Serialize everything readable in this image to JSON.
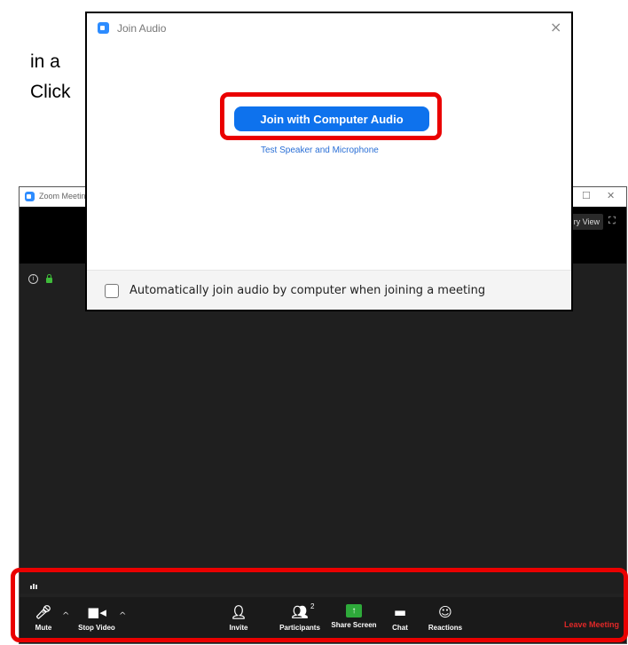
{
  "background": {
    "line1": "in a",
    "line2": "Click"
  },
  "zoom_window": {
    "title": "Zoom Meeting",
    "view_label": "Gallery View",
    "view_label_visible": "ry View",
    "toolbar": {
      "mute": "Mute",
      "stop_video": "Stop Video",
      "invite": "Invite",
      "participants": "Participants",
      "participant_count": "2",
      "share_screen": "Share Screen",
      "chat": "Chat",
      "reactions": "Reactions",
      "leave": "Leave Meeting"
    }
  },
  "dialog": {
    "title": "Join Audio",
    "join_button": "Join with Computer Audio",
    "test_link": "Test Speaker and Microphone",
    "auto_join_label": "Automatically join audio by computer when joining a meeting",
    "auto_join_checked": false
  },
  "colors": {
    "accent": "#0e72ed",
    "highlight": "#ea0000",
    "share_green": "#2eaa3a",
    "leave_red": "#e02828"
  }
}
